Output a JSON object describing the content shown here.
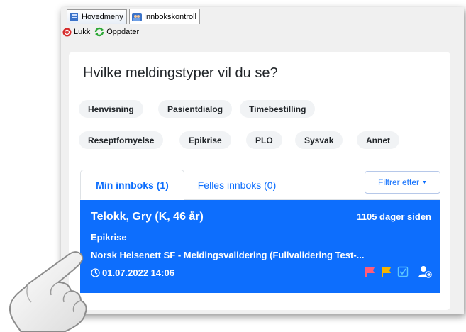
{
  "window": {
    "tabs": [
      {
        "label": "Hovedmeny"
      },
      {
        "label": "Innbokskontroll"
      }
    ],
    "toolbar": {
      "close_label": "Lukk",
      "refresh_label": "Oppdater"
    }
  },
  "filter_section": {
    "heading": "Hvilke meldingstyper vil du se?",
    "chips": [
      "Henvisning",
      "Pasientdialog",
      "Timebestilling",
      "Reseptfornyelse",
      "Epikrise",
      "PLO",
      "Sysvak",
      "Annet"
    ]
  },
  "inbox": {
    "tabs": [
      {
        "label": "Min innboks (1)"
      },
      {
        "label": "Felles innboks (0)"
      }
    ],
    "filter_button": "Filtrer etter",
    "messages": [
      {
        "patient": "Telokk, Gry (K, 46 år)",
        "age": "1105 dager siden",
        "type": "Epikrise",
        "sender": "Norsk Helsenett SF - Meldingsvalidering (Fullvalidering Test-...",
        "datetime": "01.07.2022 14:06"
      }
    ]
  },
  "colors": {
    "primary": "#0d6efd",
    "chip_bg": "#f1f3f5",
    "flag_red": "#ff5c7a",
    "flag_yellow": "#f5b400",
    "check": "#5ec8ff"
  },
  "icons": [
    "home-icon",
    "inbox-icon",
    "close-icon",
    "refresh-icon",
    "clock-icon",
    "red-flag-icon",
    "yellow-flag-icon",
    "checkbox-icon",
    "assign-user-icon",
    "hand-pointer-icon"
  ]
}
